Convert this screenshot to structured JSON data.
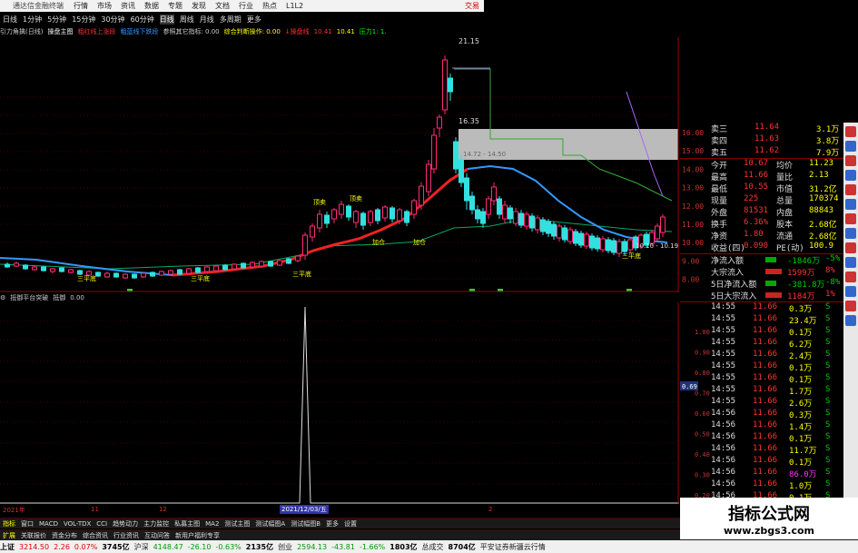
{
  "menubar": {
    "app_title": "通达信金融终端",
    "items": [
      "行情",
      "市场",
      "资讯",
      "数据",
      "专题",
      "发现",
      "文档",
      "行业",
      "热点",
      "L1L2"
    ],
    "trade": "交易"
  },
  "toolbar": {
    "items": [
      "日线",
      "1分钟",
      "5分钟",
      "15分钟",
      "30分钟",
      "60分钟",
      "日线",
      "周线",
      "月线",
      "多周期",
      "更多"
    ],
    "active_index": 6
  },
  "indicator_bar": {
    "items": [
      {
        "text": "引力角擒(日线)",
        "color": "#ccc"
      },
      {
        "text": "操盘主图",
        "color": "#fff"
      },
      {
        "text": "粗红线上涨段",
        "color": "#e33"
      },
      {
        "text": "粗蓝线下跌段",
        "color": "#39f"
      },
      {
        "text": "参照其它指标: 0.00",
        "color": "#ccc"
      },
      {
        "text": "综合判断操作: 0.00",
        "color": "#ff0"
      },
      {
        "text": "↓操盘线",
        "color": "#f33"
      },
      {
        "text": "10.41",
        "color": "#f33"
      },
      {
        "text": "10.41",
        "color": "#ff0"
      },
      {
        "text": "压力1: 1.",
        "color": "#0f0"
      }
    ]
  },
  "sub_indicator": {
    "name": "抵御平台突破",
    "label": "抵御",
    "value": "0.00"
  },
  "chart_labels": {
    "high_price": "21.15",
    "mid_price": "16.35",
    "box_label": "14.72 - 14.50",
    "low_range": "10.10 - 10.19",
    "annotations": [
      "三平底",
      "三平底",
      "三平底",
      "三平底",
      "顶卖",
      "顶卖",
      "加仓",
      "加仓"
    ],
    "date_left": "2021年",
    "date_cursor": "2021/12/03/五",
    "date_marks": [
      "11",
      "12",
      "2"
    ]
  },
  "price_ticks": [
    "16.00",
    "15.00",
    "14.00",
    "13.00",
    "12.00",
    "11.00",
    "10.00",
    "9.00",
    "8.00"
  ],
  "sub_ticks": [
    "1.00",
    "0.90",
    "0.80",
    "0.70",
    "0.60",
    "0.50",
    "0.40",
    "0.30",
    "0.20",
    "0.10"
  ],
  "sub_tick_current": "0.69",
  "quote_panel": {
    "asks": [
      {
        "label": "卖三",
        "price": "11.64",
        "vol": "3.1万"
      },
      {
        "label": "卖四",
        "price": "11.63",
        "vol": "3.8万"
      },
      {
        "label": "卖五",
        "price": "11.62",
        "vol": "7.9万"
      }
    ],
    "stats": [
      {
        "l1": "今开",
        "v1": "10.67",
        "l2": "均价",
        "v2": "11.23"
      },
      {
        "l1": "最高",
        "v1": "11.66",
        "l2": "量比",
        "v2": "2.13"
      },
      {
        "l1": "最低",
        "v1": "10.55",
        "l2": "市值",
        "v2": "31.2亿"
      },
      {
        "l1": "现量",
        "v1": "225",
        "l2": "总量",
        "v2": "170374"
      },
      {
        "l1": "外盘",
        "v1": "81531",
        "l2": "内盘",
        "v2": "88843"
      },
      {
        "l1": "换手",
        "v1": "6.36%",
        "l2": "股本",
        "v2": "2.68亿"
      },
      {
        "l1": "净资",
        "v1": "1.80",
        "l2": "流通",
        "v2": "2.68亿"
      },
      {
        "l1": "收益(四)",
        "v1": "0.090",
        "l2": "PE(动)",
        "v2": "100.9"
      }
    ],
    "flows": [
      {
        "label": "净流入额",
        "value": "-1846万",
        "pct": "-5%"
      },
      {
        "label": "大宗流入",
        "value": "1599万",
        "pct": "8%"
      },
      {
        "label": "5日净流入额",
        "value": "-381.8万",
        "pct": "-8%"
      },
      {
        "label": "5日大宗流入",
        "value": "1184万",
        "pct": "1%"
      }
    ],
    "ticks": [
      {
        "time": "14:55",
        "price": "11.66",
        "vol": "0.3万",
        "side": "S"
      },
      {
        "time": "14:55",
        "price": "11.66",
        "vol": "23.4万",
        "side": "S"
      },
      {
        "time": "14:55",
        "price": "11.66",
        "vol": "0.1万",
        "side": "S"
      },
      {
        "time": "14:55",
        "price": "11.66",
        "vol": "6.2万",
        "side": "S"
      },
      {
        "time": "14:55",
        "price": "11.66",
        "vol": "2.4万",
        "side": "S"
      },
      {
        "time": "14:55",
        "price": "11.66",
        "vol": "0.1万",
        "side": "S"
      },
      {
        "time": "14:55",
        "price": "11.66",
        "vol": "0.1万",
        "side": "S"
      },
      {
        "time": "14:55",
        "price": "11.66",
        "vol": "1.7万",
        "side": "S"
      },
      {
        "time": "14:55",
        "price": "11.66",
        "vol": "2.6万",
        "side": "S"
      },
      {
        "time": "14:56",
        "price": "11.66",
        "vol": "0.3万",
        "side": "S"
      },
      {
        "time": "14:56",
        "price": "11.66",
        "vol": "1.4万",
        "side": "S"
      },
      {
        "time": "14:56",
        "price": "11.66",
        "vol": "0.1万",
        "side": "S"
      },
      {
        "time": "14:56",
        "price": "11.66",
        "vol": "11.7万",
        "side": "S"
      },
      {
        "time": "14:56",
        "price": "11.66",
        "vol": "0.1万",
        "side": "S"
      },
      {
        "time": "14:56",
        "price": "11.66",
        "vol": "86.0万",
        "side": "S"
      },
      {
        "time": "14:56",
        "price": "11.66",
        "vol": "1.0万",
        "side": "S"
      },
      {
        "time": "14:56",
        "price": "11.66",
        "vol": "0.1万",
        "side": "S"
      },
      {
        "time": "14:56",
        "price": "11.66",
        "vol": "0.1万",
        "side": "S"
      }
    ]
  },
  "tabs": {
    "items": [
      "指标",
      "窗口",
      "MACD",
      "VOL-TDX",
      "CCI",
      "趋势动力",
      "主力监控",
      "私募主图",
      "MA2",
      "测试主图",
      "测试幅图A",
      "测试幅图B",
      "更多",
      "设置"
    ],
    "active_index": 0,
    "left_items": [
      "扩展",
      "关联报价",
      "资金分布",
      "综合资讯",
      "行业资讯",
      "互动问答",
      "新用户福利专享"
    ]
  },
  "statusbar": {
    "items": [
      {
        "text": "上证",
        "cls": "blk"
      },
      {
        "text": "3214.50",
        "cls": "red"
      },
      {
        "text": "2.26",
        "cls": "red"
      },
      {
        "text": "0.07%",
        "cls": "red"
      },
      {
        "text": "3745亿",
        "cls": "blk"
      },
      {
        "text": "沪深",
        "cls": ""
      },
      {
        "text": "4148.47",
        "cls": "grn"
      },
      {
        "text": "-26.10",
        "cls": "grn"
      },
      {
        "text": "-0.63%",
        "cls": "grn"
      },
      {
        "text": "2135亿",
        "cls": "blk"
      },
      {
        "text": "创业",
        "cls": ""
      },
      {
        "text": "2594.13",
        "cls": "grn"
      },
      {
        "text": "-43.81",
        "cls": "grn"
      },
      {
        "text": "-1.66%",
        "cls": "grn"
      },
      {
        "text": "1803亿",
        "cls": "blk"
      },
      {
        "text": "总成交",
        "cls": ""
      },
      {
        "text": "8704亿",
        "cls": "blk"
      },
      {
        "text": "平安证券新疆云行情",
        "cls": ""
      }
    ]
  },
  "watermark": {
    "title": "指标公式网",
    "url": "www.zbgs3.com"
  },
  "colors": {
    "up": "#ff3333",
    "down": "#33ffff",
    "ma_red": "#e82020",
    "ma_blue": "#3388ff",
    "grid_red": "#700"
  }
}
